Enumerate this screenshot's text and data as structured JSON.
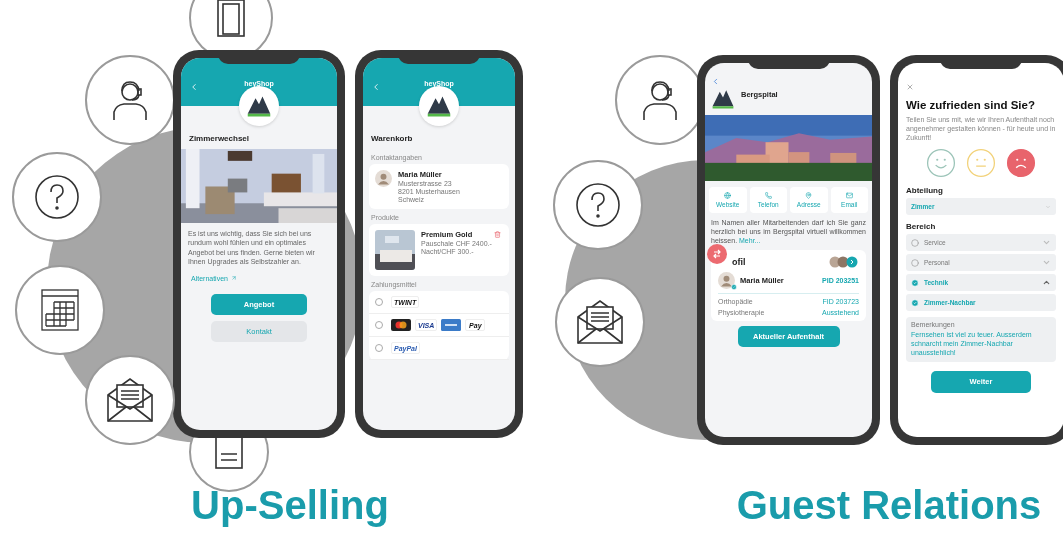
{
  "sections": [
    {
      "title": "Up-Selling",
      "phones": [
        {
          "kind": "offer",
          "header": "heyShop",
          "heading": "Zimmerwechsel",
          "text": "Es ist uns wichtig, dass Sie sich bei uns rundum wohl fühlen und ein optimales Angebot bei uns finden. Gerne bieten wir Ihnen Upgrades als Selbstzahler an.",
          "link": "Alternativen",
          "buttons": [
            {
              "label": "Angebot",
              "primary": true
            },
            {
              "label": "Kontakt",
              "primary": false
            }
          ]
        },
        {
          "kind": "cart",
          "header": "heyShop",
          "heading": "Warenkorb",
          "contact_label": "Kontaktangaben",
          "contact": {
            "name": "Maria Müller",
            "lines": [
              "Musterstrasse 23",
              "8201 Musterhausen",
              "Schweiz"
            ]
          },
          "products_label": "Produkte",
          "product": {
            "name": "Premium Gold",
            "lines": [
              "Pauschale CHF 2400.-",
              "Nacht/CHF 300.-"
            ]
          },
          "payment_label": "Zahlungsmittel",
          "payments": [
            {
              "selected": false,
              "methods": [
                {
                  "kind": "twint",
                  "label": "TWINT"
                }
              ]
            },
            {
              "selected": false,
              "methods": [
                {
                  "kind": "mastercard"
                },
                {
                  "kind": "visa",
                  "label": "VISA"
                },
                {
                  "kind": "amex"
                },
                {
                  "kind": "applepay",
                  "label": "Pay"
                }
              ]
            },
            {
              "selected": false,
              "methods": [
                {
                  "kind": "paypal",
                  "label": "PayPal"
                }
              ]
            }
          ]
        }
      ]
    },
    {
      "title": "Guest Relations",
      "phones": [
        {
          "kind": "hospital",
          "name": "Bergspital",
          "actions": [
            {
              "kind": "web",
              "label": "Website"
            },
            {
              "kind": "phone",
              "label": "Telefon"
            },
            {
              "kind": "address",
              "label": "Adresse"
            },
            {
              "kind": "mail",
              "label": "Email"
            }
          ],
          "text": "Im Namen aller Mitarbeitenden darf ich Sie ganz herzlich bei uns im Bergspital virtuell willkommen heissen.",
          "link": "Mehr...",
          "profile": {
            "heading": "ofil",
            "patient": "Maria Müller",
            "pid": "PID 203251",
            "rows": [
              {
                "label": "Orthopädie",
                "value": "FID 203723"
              },
              {
                "label": "Physiotherapie",
                "value": "Ausstehend"
              }
            ]
          },
          "button": "Aktueller Aufenthalt"
        },
        {
          "kind": "survey",
          "title": "Wie zufrieden sind Sie?",
          "subtitle": "Teilen Sie uns mit, wie wir Ihren Aufenthalt noch angenehmer gestalten können - für heute und in Zukunft!",
          "faces": [
            {
              "kind": "happy",
              "selected": false
            },
            {
              "kind": "neutral",
              "selected": false
            },
            {
              "kind": "sad",
              "selected": true
            }
          ],
          "department_label": "Abteilung",
          "department": "Zimmer",
          "area_label": "Bereich",
          "options": [
            {
              "label": "Service",
              "checked": false,
              "expanded": false
            },
            {
              "label": "Personal",
              "checked": false,
              "expanded": false
            },
            {
              "label": "Technik",
              "checked": true,
              "expanded": true
            },
            {
              "label": "Zimmer-Nachbar",
              "checked": true
            }
          ],
          "remarks_label": "Bemerkungen",
          "remarks": "Fernsehen ist viel zu teuer. Ausserdem schnarcht mein Zimmer-Nachbar unausstehlich!",
          "button": "Weiter"
        }
      ]
    }
  ]
}
